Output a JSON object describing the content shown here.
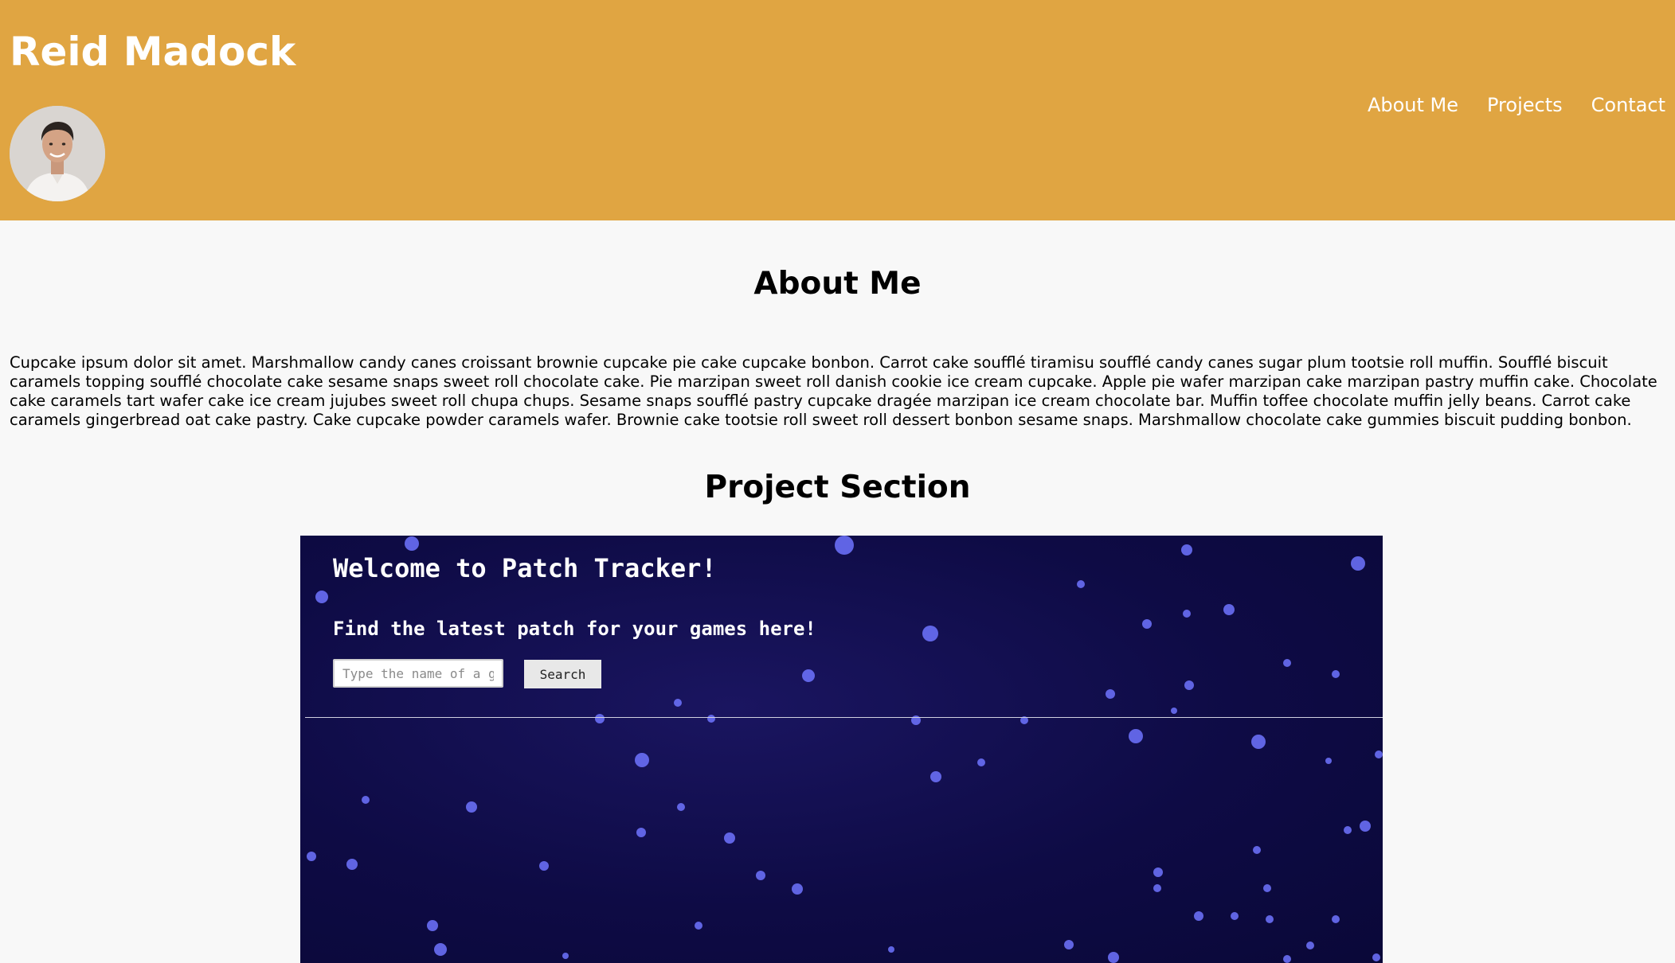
{
  "header": {
    "site_title": "Reid Madock",
    "nav": [
      {
        "label": "About Me"
      },
      {
        "label": "Projects"
      },
      {
        "label": "Contact"
      }
    ],
    "background_color": "#e0a542"
  },
  "about": {
    "heading": "About Me",
    "body": "Cupcake ipsum dolor sit amet. Marshmallow candy canes croissant brownie cupcake pie cake cupcake bonbon. Carrot cake soufflé tiramisu soufflé candy canes sugar plum tootsie roll muffin. Soufflé biscuit caramels topping soufflé chocolate cake sesame snaps sweet roll chocolate cake. Pie marzipan sweet roll danish cookie ice cream cupcake. Apple pie wafer marzipan cake marzipan pastry muffin cake. Chocolate cake caramels tart wafer cake ice cream jujubes sweet roll chupa chups. Sesame snaps soufflé pastry cupcake dragée marzipan ice cream chocolate bar. Muffin toffee chocolate muffin jelly beans. Carrot cake caramels gingerbread oat cake pastry. Cake cupcake powder caramels wafer. Brownie cake tootsie roll sweet roll dessert bonbon sesame snaps. Marshmallow chocolate cake gummies biscuit pudding bonbon."
  },
  "projects": {
    "heading": "Project Section",
    "preview": {
      "title": "Welcome to Patch Tracker!",
      "subtitle": "Find the latest patch for your games here!",
      "search_placeholder": "Type the name of a game",
      "search_button": "Search",
      "background_color": "#0e0b45"
    }
  }
}
